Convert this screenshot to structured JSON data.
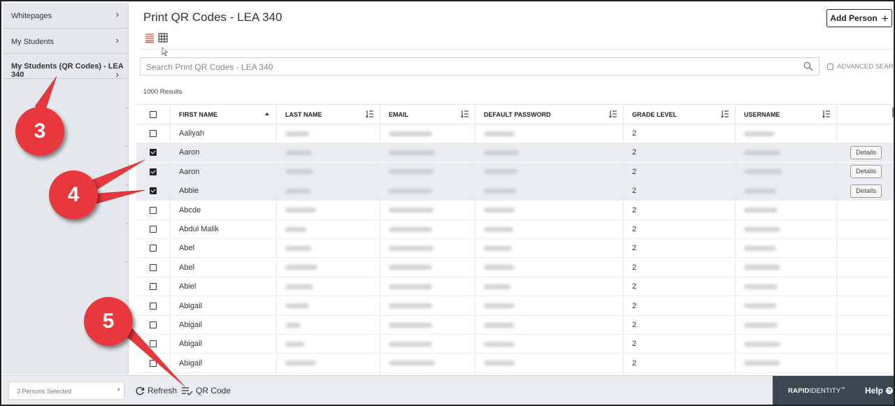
{
  "sidebar": {
    "items": [
      {
        "label": "Whitepages",
        "chevron": "›"
      },
      {
        "label": "My Students",
        "chevron": "›"
      },
      {
        "label": "My Students (QR Codes) - LEA 340",
        "chevron": "›"
      }
    ]
  },
  "header": {
    "title": "Print QR Codes - LEA 340",
    "add_person_label": "Add Person",
    "add_icon": "+"
  },
  "search": {
    "placeholder": "Search Print QR Codes - LEA 340",
    "advanced_label": "ADVANCED SEARCH"
  },
  "results_count": "1000 Results",
  "table": {
    "columns": [
      "FIRST NAME",
      "LAST NAME",
      "EMAIL",
      "DEFAULT PASSWORD",
      "GRADE LEVEL",
      "USERNAME"
    ],
    "rows": [
      {
        "first_name": "Aaliyah",
        "grade": "2",
        "selected": false
      },
      {
        "first_name": "Aaron",
        "grade": "2",
        "selected": true,
        "details": "Details"
      },
      {
        "first_name": "Aaron",
        "grade": "2",
        "selected": true,
        "details": "Details"
      },
      {
        "first_name": "Abbie",
        "grade": "2",
        "selected": true,
        "details": "Details"
      },
      {
        "first_name": "Abcde",
        "grade": "2",
        "selected": false
      },
      {
        "first_name": "Abdul Malik",
        "grade": "2",
        "selected": false
      },
      {
        "first_name": "Abel",
        "grade": "2",
        "selected": false
      },
      {
        "first_name": "Abel",
        "grade": "2",
        "selected": false
      },
      {
        "first_name": "Abiel",
        "grade": "2",
        "selected": false
      },
      {
        "first_name": "Abigail",
        "grade": "2",
        "selected": false
      },
      {
        "first_name": "Abigail",
        "grade": "2",
        "selected": false
      },
      {
        "first_name": "Abigail",
        "grade": "2",
        "selected": false
      },
      {
        "first_name": "Abigail",
        "grade": "2",
        "selected": false
      },
      {
        "first_name": "",
        "grade": "",
        "selected": false
      }
    ]
  },
  "footer": {
    "persons_selected": "3 Persons Selected",
    "refresh_label": "Refresh",
    "qr_label": "QR Code",
    "brand_bold": "RAPID",
    "brand_light": "IDENTITY",
    "brand_tm": "™",
    "help_label": "Help",
    "help_icon": "?"
  },
  "callouts": [
    "3",
    "4",
    "5"
  ],
  "colors": {
    "callout": "#e8383d",
    "brand_bar": "#3c4751",
    "sidebar_bg": "#e4e8ec",
    "selected_row": "#e9edf1"
  }
}
